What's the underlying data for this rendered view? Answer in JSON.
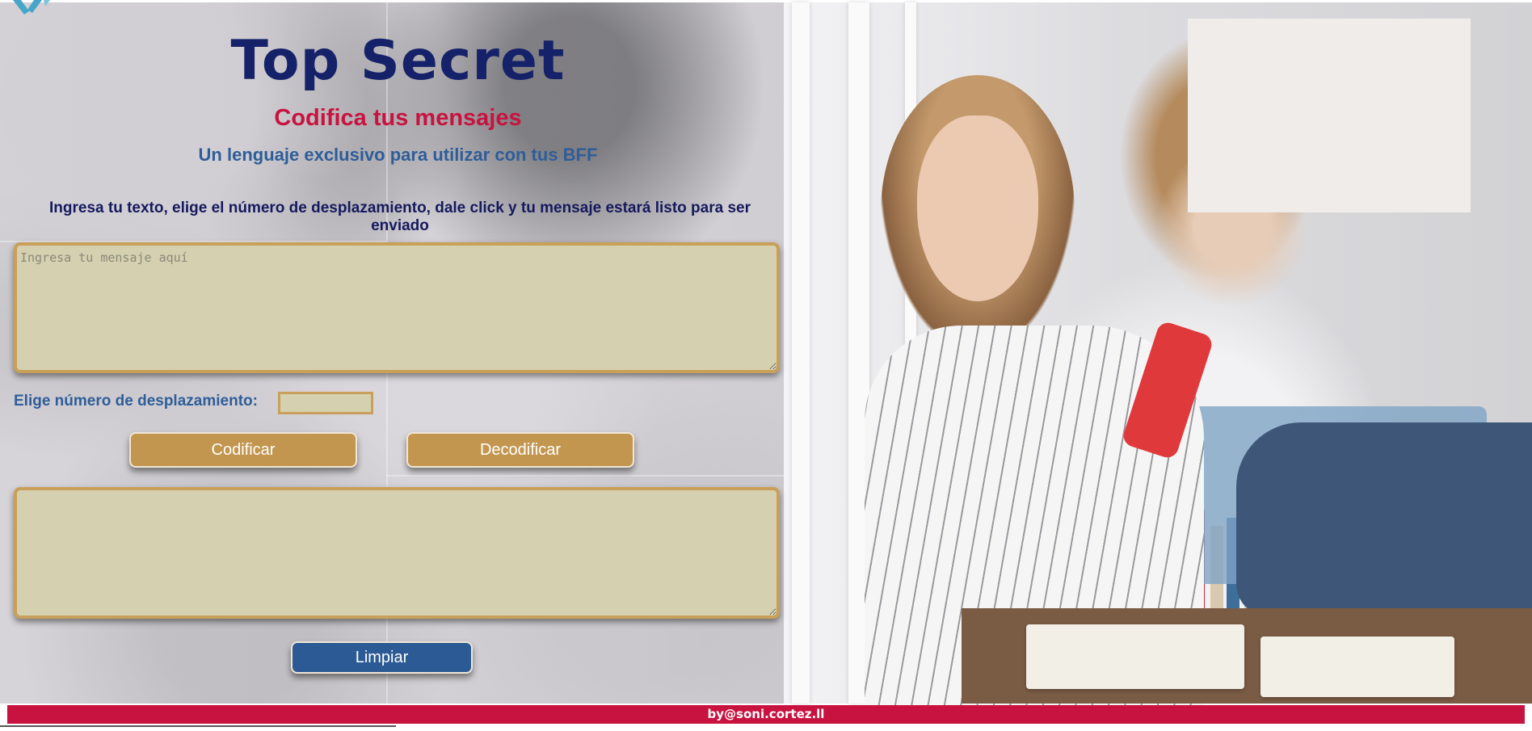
{
  "header": {
    "title": "Top Secret",
    "subtitle": "Codifica tus mensajes",
    "tagline": "Un lenguaje exclusivo para utilizar con tus BFF"
  },
  "instructions": "Ingresa tu texto, elige el número de desplazamiento, dale click y tu mensaje estará listo para ser enviado",
  "message_input": {
    "value": "",
    "placeholder": "Ingresa tu mensaje aquí"
  },
  "shift": {
    "label": "Elige número de desplazamiento:",
    "value": ""
  },
  "buttons": {
    "encode": "Codificar",
    "decode": "Decodificar",
    "clear": "Limpiar"
  },
  "result_output": {
    "value": ""
  },
  "footer": {
    "credit": "by@soni.cortez.ll"
  },
  "colors": {
    "title": "#152269",
    "subtitle": "#c8123f",
    "tagline": "#2e5d99",
    "textarea_bg": "#d4d0b0",
    "textarea_border": "#c9a05a",
    "button_gold": "#c2964f",
    "button_blue": "#2b5a94",
    "footer_bg": "#c8123f"
  },
  "icons": {
    "corner_logo": "logo-icon"
  }
}
